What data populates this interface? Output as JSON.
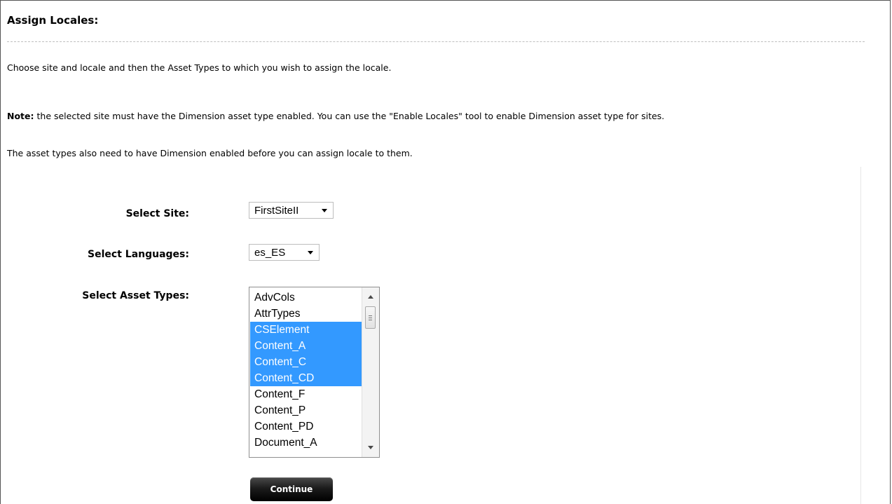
{
  "page": {
    "title": "Assign Locales:",
    "intro": "Choose site and locale and then the Asset Types to which you wish to assign the locale.",
    "note_label": "Note:",
    "note_text": " the selected site must have the Dimension asset type enabled. You can use the \"Enable Locales\" tool to enable Dimension asset type for sites.",
    "asset_types_note": "The asset types also need to have Dimension enabled before you can assign locale to them."
  },
  "form": {
    "site_label": "Select Site:",
    "site_value": "FirstSiteII",
    "languages_label": "Select Languages:",
    "languages_value": "es_ES",
    "asset_types_label": "Select Asset Types:",
    "asset_types": [
      {
        "label": "AdvCols",
        "selected": false
      },
      {
        "label": "AttrTypes",
        "selected": false
      },
      {
        "label": "CSElement",
        "selected": true
      },
      {
        "label": "Content_A",
        "selected": true
      },
      {
        "label": "Content_C",
        "selected": true
      },
      {
        "label": "Content_CD",
        "selected": true
      },
      {
        "label": "Content_F",
        "selected": false
      },
      {
        "label": "Content_P",
        "selected": false
      },
      {
        "label": "Content_PD",
        "selected": false
      },
      {
        "label": "Document_A",
        "selected": false
      }
    ],
    "continue_label": "Continue"
  },
  "colors": {
    "selection": "#3399ff",
    "button": "#1c1c1c"
  }
}
